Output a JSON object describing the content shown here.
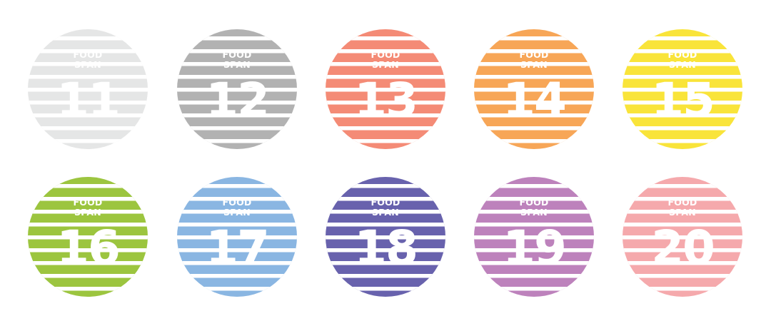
{
  "badges": [
    {
      "brand_line1": "FOOD",
      "brand_line2": "SPAN",
      "number": "11",
      "color": "#e5e6e6"
    },
    {
      "brand_line1": "FOOD",
      "brand_line2": "SPAN",
      "number": "12",
      "color": "#b2b2b2"
    },
    {
      "brand_line1": "FOOD",
      "brand_line2": "SPAN",
      "number": "13",
      "color": "#f48b76"
    },
    {
      "brand_line1": "FOOD",
      "brand_line2": "SPAN",
      "number": "14",
      "color": "#f7a657"
    },
    {
      "brand_line1": "FOOD",
      "brand_line2": "SPAN",
      "number": "15",
      "color": "#f9e43a"
    },
    {
      "brand_line1": "FOOD",
      "brand_line2": "SPAN",
      "number": "16",
      "color": "#9cc53f"
    },
    {
      "brand_line1": "FOOD",
      "brand_line2": "SPAN",
      "number": "17",
      "color": "#8ab6e2"
    },
    {
      "brand_line1": "FOOD",
      "brand_line2": "SPAN",
      "number": "18",
      "color": "#6862ad"
    },
    {
      "brand_line1": "FOOD",
      "brand_line2": "SPAN",
      "number": "19",
      "color": "#bd82bc"
    },
    {
      "brand_line1": "FOOD",
      "brand_line2": "SPAN",
      "number": "20",
      "color": "#f5a9ac"
    }
  ]
}
